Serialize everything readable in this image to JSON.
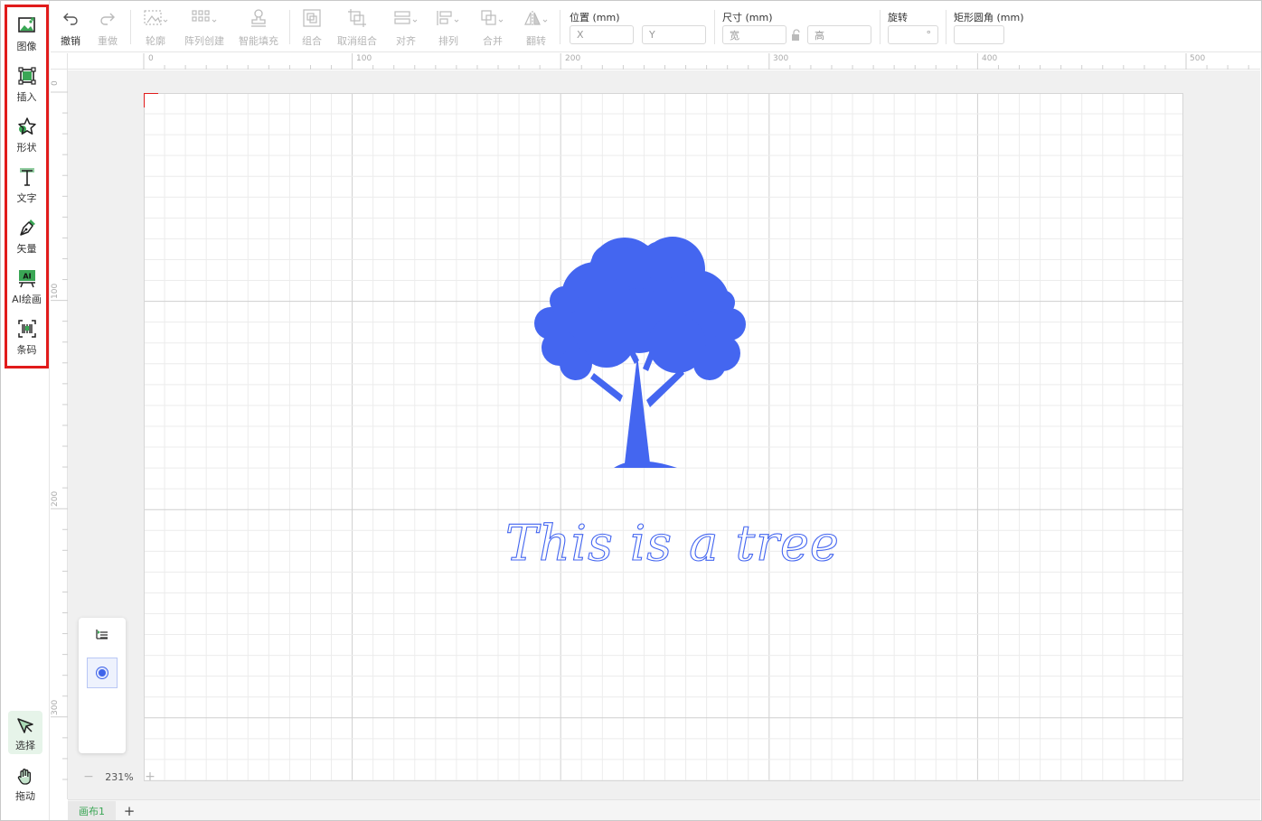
{
  "sidebar": {
    "tools": [
      {
        "label": "图像",
        "icon": "image-icon"
      },
      {
        "label": "插入",
        "icon": "insert-frame-icon"
      },
      {
        "label": "形状",
        "icon": "star-shape-icon"
      },
      {
        "label": "文字",
        "icon": "text-icon"
      },
      {
        "label": "矢量",
        "icon": "pen-vector-icon"
      },
      {
        "label": "AI绘画",
        "icon": "ai-paint-icon"
      },
      {
        "label": "条码",
        "icon": "barcode-icon"
      }
    ],
    "select_label": "选择",
    "pan_label": "拖动"
  },
  "toolbar": {
    "undo": "撤销",
    "redo": "重做",
    "outline": "轮廓",
    "array": "阵列创建",
    "smart_fill": "智能填充",
    "group": "组合",
    "ungroup": "取消组合",
    "align": "对齐",
    "arrange": "排列",
    "merge": "合并",
    "flip": "翻转",
    "position_label": "位置 (mm)",
    "x_placeholder": "X",
    "y_placeholder": "Y",
    "size_label": "尺寸 (mm)",
    "width_placeholder": "宽",
    "height_placeholder": "高",
    "rotate_label": "旋转",
    "rotate_unit": "°",
    "corner_label": "矩形圆角 (mm)"
  },
  "ruler": {
    "top_marks": [
      "0",
      "100",
      "200",
      "300",
      "400",
      "500"
    ],
    "left_marks": [
      "0",
      "100",
      "200",
      "300"
    ]
  },
  "canvas": {
    "text": "This is a tree",
    "accent_color": "#4466f0",
    "origin_marker_color": "#e11b1b"
  },
  "zoom": {
    "minus": "−",
    "value": "231%",
    "plus": "+"
  },
  "tabs": {
    "items": [
      "画布1"
    ],
    "add": "+"
  },
  "colors": {
    "brand_green": "#3aa655",
    "highlight_red": "#e11b1b",
    "tree_blue": "#4466f0"
  }
}
